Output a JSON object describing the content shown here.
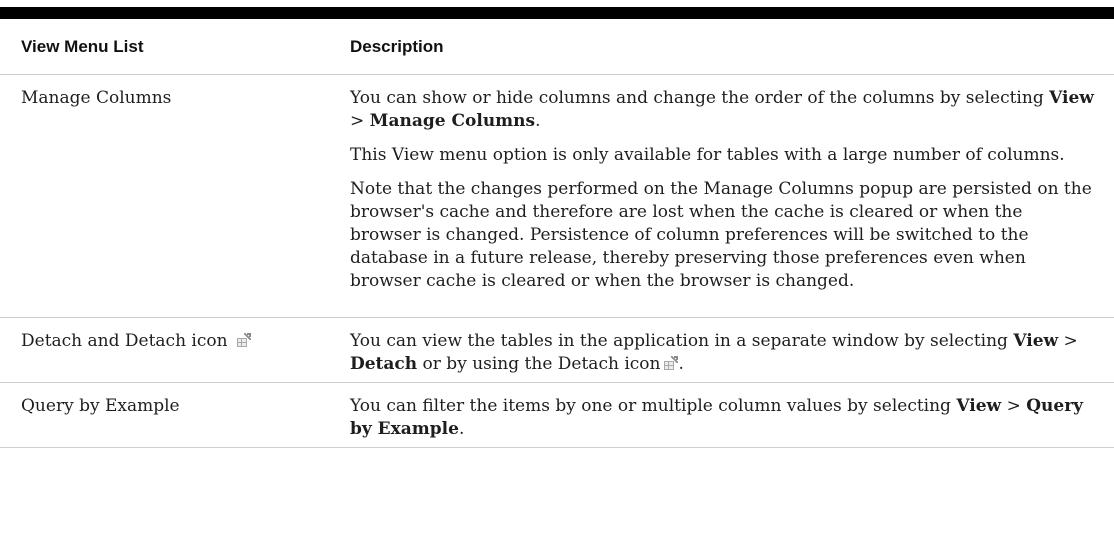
{
  "table": {
    "headers": {
      "col1": "View Menu List",
      "col2": "Description"
    },
    "rows": [
      {
        "name": "Manage Columns",
        "paragraphs": [
          {
            "segments": [
              {
                "text": "You can show or hide columns and change the order of the columns by selecting ",
                "bold": false
              },
              {
                "text": "View",
                "bold": true
              },
              {
                "text": " > ",
                "bold": false
              },
              {
                "text": "Manage Columns",
                "bold": true
              },
              {
                "text": ".",
                "bold": false
              }
            ]
          },
          {
            "segments": [
              {
                "text": "This View menu option is only available for tables with a large number of columns.",
                "bold": false
              }
            ]
          },
          {
            "segments": [
              {
                "text": "Note that the changes performed on the Manage Columns popup are persisted on the browser's cache and therefore are lost when the cache is cleared or when the browser is changed. Persistence of column preferences will be switched to the database in a future release, thereby preserving those preferences even when browser cache is cleared or when the browser is changed.",
                "bold": false
              }
            ]
          }
        ]
      },
      {
        "name": "Detach and Detach icon",
        "name_icon": "detach-icon",
        "paragraphs": [
          {
            "segments": [
              {
                "text": "You can view the tables in the application in a separate window by selecting ",
                "bold": false
              },
              {
                "text": "View",
                "bold": true
              },
              {
                "text": " > ",
                "bold": false
              },
              {
                "text": "Detach",
                "bold": true
              },
              {
                "text": " or by using the Detach icon",
                "bold": false
              },
              {
                "icon": "detach-icon"
              },
              {
                "text": ".",
                "bold": false
              }
            ]
          }
        ]
      },
      {
        "name": "Query by Example",
        "paragraphs": [
          {
            "segments": [
              {
                "text": "You can filter the items by one or multiple column values by selecting ",
                "bold": false
              },
              {
                "text": "View",
                "bold": true
              },
              {
                "text": " > ",
                "bold": false
              },
              {
                "text": "Query by Example",
                "bold": true
              },
              {
                "text": ".",
                "bold": false
              }
            ]
          }
        ]
      }
    ]
  }
}
